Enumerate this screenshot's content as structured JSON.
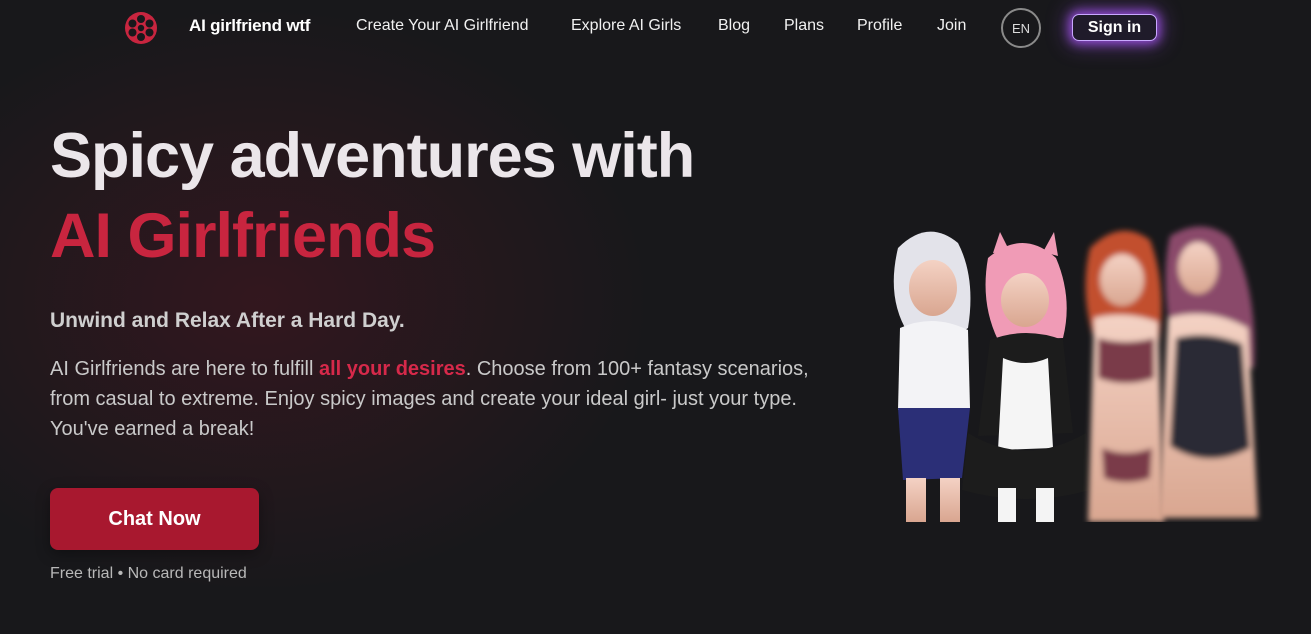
{
  "nav": {
    "brand": "AI girlfriend wtf",
    "links": [
      {
        "label": "Create Your AI Girlfriend"
      },
      {
        "label": "Explore AI Girls"
      },
      {
        "label": "Blog"
      },
      {
        "label": "Plans"
      },
      {
        "label": "Profile"
      },
      {
        "label": "Join"
      }
    ],
    "language": "EN",
    "sign_in": "Sign in",
    "logo_icon": "film-reel-icon"
  },
  "hero": {
    "title_line1": "Spicy adventures with",
    "title_line2": "AI Girlfriends",
    "subtitle": "Unwind and Relax After a Hard Day.",
    "body_before": "AI Girlfriends are here to fulfill ",
    "body_highlight": "all your desires",
    "body_after": ". Choose from 100+ fantasy scenarios, from casual to extreme. Enjoy spicy images and create your ideal girl- just your type. You've earned a break!",
    "cta": "Chat Now",
    "fineprint": "Free trial • No card required"
  },
  "colors": {
    "accent": "#c8253f",
    "cta": "#a8182f",
    "signin_glow": "#a855f7",
    "background": "#18181b"
  }
}
